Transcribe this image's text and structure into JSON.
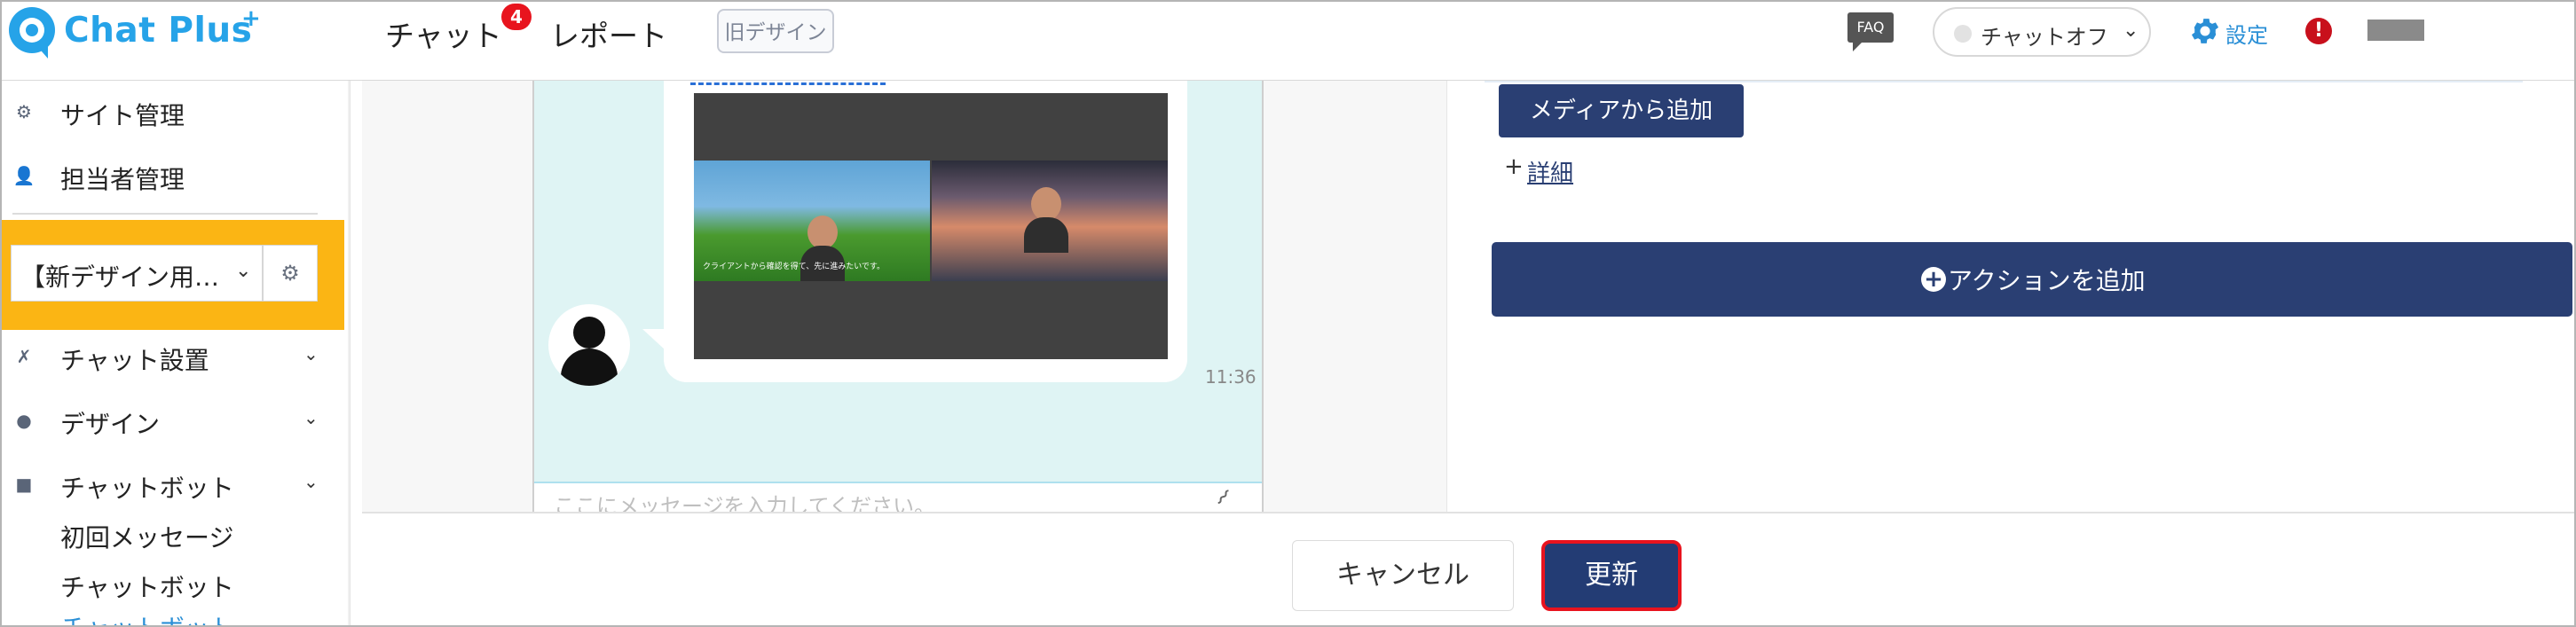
{
  "header": {
    "logo_text": "Chat Plus",
    "logo_plus": "+",
    "nav": {
      "chat_label": "チャット",
      "chat_badge": "4",
      "report_label": "レポート"
    },
    "old_design_label": "旧デザイン",
    "faq_label": "FAQ",
    "chat_status": {
      "label": "チャットオフ",
      "chevron": "⌄"
    },
    "settings_label": "設定",
    "alert_glyph": "!"
  },
  "sidebar": {
    "items": [
      {
        "label": "サイト管理",
        "icon": "gear-icon"
      },
      {
        "label": "担当者管理",
        "icon": "user-gear-icon"
      }
    ],
    "site_select": {
      "label": "【新デザイン用…",
      "chevron": "⌄"
    },
    "sections": [
      {
        "label": "チャット設置",
        "icon": "tools-icon",
        "chevron": "⌄"
      },
      {
        "label": "デザイン",
        "icon": "palette-icon",
        "chevron": "⌄"
      },
      {
        "label": "チャットボット",
        "icon": "chat-icon",
        "chevron": "⌄"
      }
    ],
    "sub_items": [
      {
        "label": "初回メッセージ"
      },
      {
        "label": "チャットボット"
      }
    ],
    "cut_item": "チャットボット"
  },
  "preview": {
    "video_caption": "クライアントから確認を得て、先に進みたいです。",
    "time": "11:36",
    "input_placeholder": "ここにメッセージを入力してください。",
    "attach_icon": "paperclip-icon"
  },
  "panel": {
    "media_button": "メディアから追加",
    "detail_plus": "+",
    "detail_link": "詳細",
    "action_plus": "+",
    "action_button": "アクションを追加"
  },
  "footer": {
    "cancel_label": "キャンセル",
    "update_label": "更新"
  },
  "colors": {
    "brand": "#26a3e8",
    "navy": "#2a3f73",
    "sidebar_highlight": "#fbb514",
    "badge": "#e8141e",
    "update_border": "#e8131e"
  }
}
